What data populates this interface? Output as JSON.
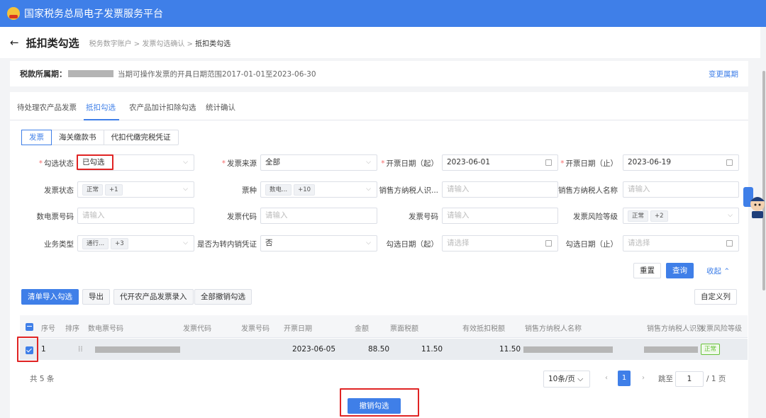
{
  "app": {
    "title": "国家税务总局电子发票服务平台"
  },
  "header": {
    "page_title": "抵扣类勾选",
    "breadcrumb": [
      "税务数字账户",
      "发票勾选确认",
      "抵扣类勾选"
    ]
  },
  "period": {
    "label": "税款所属期：",
    "range_text": "当期可操作发票的开具日期范围2017-01-01至2023-06-30",
    "change_link": "变更属期"
  },
  "tabs": [
    "待处理农产品发票",
    "抵扣勾选",
    "农产品加计扣除勾选",
    "统计确认"
  ],
  "doc_types": [
    "发票",
    "海关缴款书",
    "代扣代缴完税凭证"
  ],
  "filters": {
    "check_status": {
      "label": "勾选状态",
      "value": "已勾选"
    },
    "invoice_source": {
      "label": "发票来源",
      "value": "全部"
    },
    "issue_date_start": {
      "label": "开票日期（起）",
      "value": "2023-06-01"
    },
    "issue_date_end": {
      "label": "开票日期（止）",
      "value": "2023-06-19"
    },
    "invoice_status": {
      "label": "发票状态",
      "tag": "正常",
      "more": "+1"
    },
    "ticket_type": {
      "label": "票种",
      "tag": "数电...",
      "more": "+10"
    },
    "seller_tax_id": {
      "label": "销售方纳税人识...",
      "placeholder": "请输入"
    },
    "seller_name": {
      "label": "销售方纳税人名称",
      "placeholder": "请输入"
    },
    "digital_invoice_no": {
      "label": "数电票号码",
      "placeholder": "请输入"
    },
    "invoice_code": {
      "label": "发票代码",
      "placeholder": "请输入"
    },
    "invoice_no": {
      "label": "发票号码",
      "placeholder": "请输入"
    },
    "risk_level": {
      "label": "发票风险等级",
      "tag": "正常",
      "more": "+2"
    },
    "business_type": {
      "label": "业务类型",
      "tag": "通行...",
      "more": "+3"
    },
    "transfer_voucher": {
      "label": "是否为转内销凭证",
      "value": "否"
    },
    "check_date_start": {
      "label": "勾选日期（起）",
      "placeholder": "请选择"
    },
    "check_date_end": {
      "label": "勾选日期（止）",
      "placeholder": "请选择"
    }
  },
  "actions": {
    "reset": "重置",
    "query": "查询",
    "collapse": "收起"
  },
  "toolbar": {
    "import": "清单导入勾选",
    "export": "导出",
    "agri_entry": "代开农产品发票录入",
    "undo_all": "全部撤销勾选",
    "custom_cols": "自定义列"
  },
  "table": {
    "headers": [
      "序号",
      "排序",
      "数电票号码",
      "发票代码",
      "发票号码",
      "开票日期",
      "金额",
      "票面税额",
      "有效抵扣税额",
      "销售方纳税人名称",
      "销售方纳税人识别",
      "发票风险等级"
    ],
    "rows": [
      {
        "index": "1",
        "issue_date": "2023-06-05",
        "amount": "88.50",
        "tax": "11.50",
        "valid_tax": "11.50",
        "risk": "正常"
      }
    ]
  },
  "pagination": {
    "total": "共 5 条",
    "page_size": "10条/页",
    "current_page": "1",
    "jump_label": "跳至",
    "jump_value": "1",
    "page_total": "/ 1 页"
  },
  "bottom": {
    "undo_selected": "撤销勾选"
  },
  "colors": {
    "primary": "#3f7fe8",
    "highlight": "#e02424",
    "success": "#67c23a"
  }
}
